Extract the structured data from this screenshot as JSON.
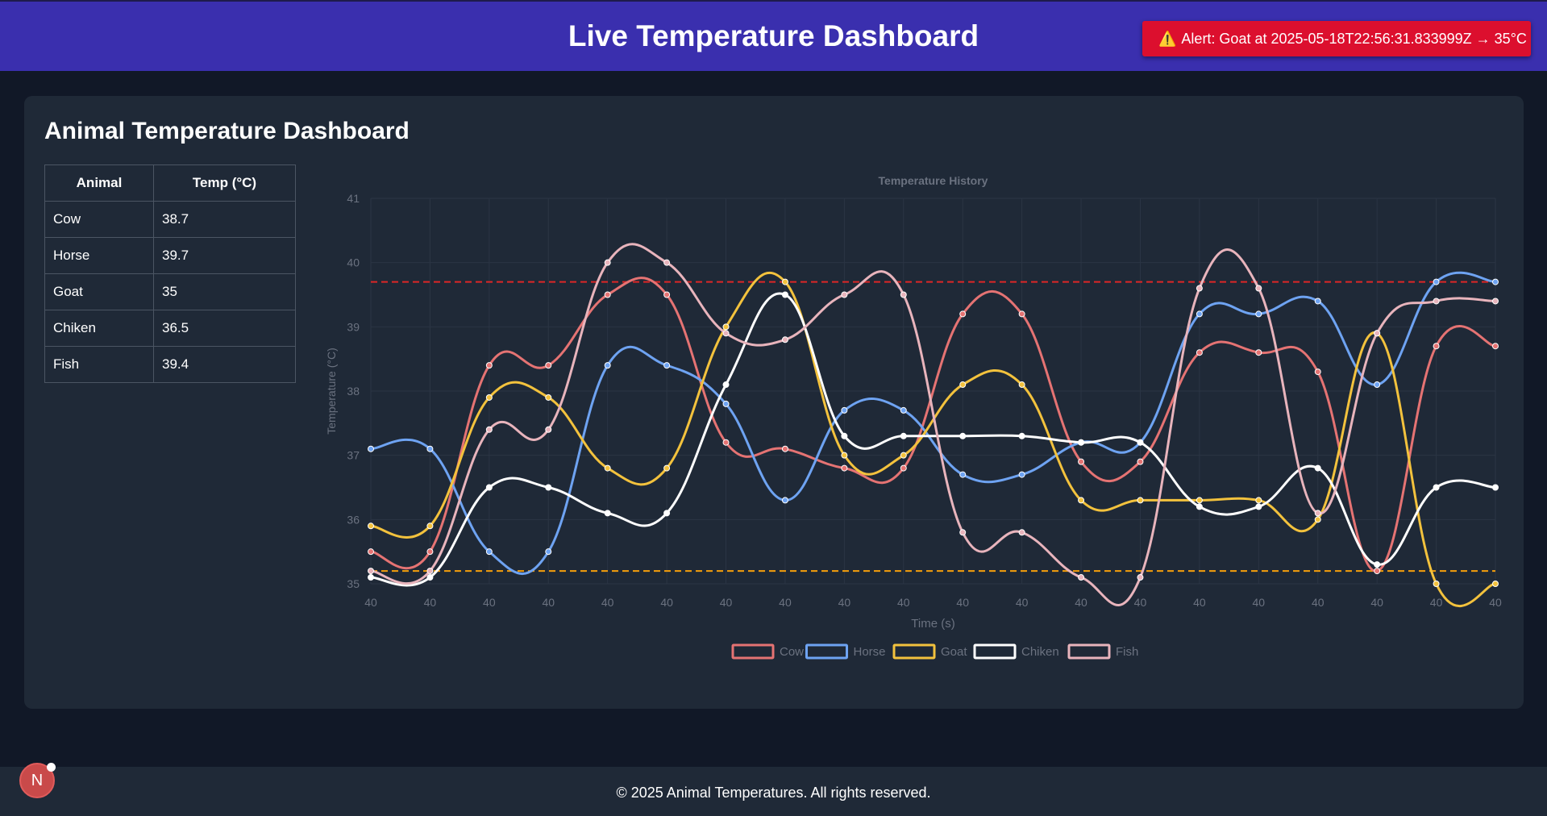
{
  "header": {
    "title": "Live Temperature Dashboard",
    "alert_icon": "⚠️",
    "alert_text": "Alert: Goat at 2025-05-18T22:56:31.833999Z → 35°C"
  },
  "main": {
    "title": "Animal Temperature Dashboard",
    "table": {
      "headers": [
        "Animal",
        "Temp (°C)"
      ],
      "rows": [
        [
          "Cow",
          "38.7"
        ],
        [
          "Horse",
          "39.7"
        ],
        [
          "Goat",
          "35"
        ],
        [
          "Chiken",
          "36.5"
        ],
        [
          "Fish",
          "39.4"
        ]
      ]
    }
  },
  "chart_data": {
    "type": "line",
    "title": "Temperature History",
    "xlabel": "Time (s)",
    "ylabel": "Temperature (°C)",
    "ylim": [
      35,
      41
    ],
    "yticks": [
      "35",
      "36",
      "37",
      "38",
      "39",
      "40",
      "41"
    ],
    "categories": [
      "40",
      "40",
      "40",
      "40",
      "40",
      "40",
      "40",
      "40",
      "40",
      "40",
      "40",
      "40",
      "40",
      "40",
      "40",
      "40",
      "40",
      "40",
      "40",
      "40"
    ],
    "grid": true,
    "legend_position": "bottom",
    "thresholds": [
      {
        "value": 39.7,
        "color": "#dc2626"
      },
      {
        "value": 35.2,
        "color": "#f59e0b"
      }
    ],
    "series": [
      {
        "name": "Cow",
        "color": "#e57373",
        "values": [
          35.5,
          35.5,
          38.4,
          38.4,
          39.5,
          39.5,
          37.2,
          37.1,
          36.8,
          36.8,
          39.2,
          39.2,
          36.9,
          36.9,
          38.6,
          38.6,
          38.3,
          35.2,
          38.7,
          38.7
        ]
      },
      {
        "name": "Horse",
        "color": "#6ea3f2",
        "values": [
          37.1,
          37.1,
          35.5,
          35.5,
          38.4,
          38.4,
          37.8,
          36.3,
          37.7,
          37.7,
          36.7,
          36.7,
          37.2,
          37.2,
          39.2,
          39.2,
          39.4,
          38.1,
          39.7,
          39.7
        ]
      },
      {
        "name": "Goat",
        "color": "#f3c23d",
        "values": [
          35.9,
          35.9,
          37.9,
          37.9,
          36.8,
          36.8,
          39.0,
          39.7,
          37.0,
          37.0,
          38.1,
          38.1,
          36.3,
          36.3,
          36.3,
          36.3,
          36.0,
          38.9,
          35.0,
          35.0
        ]
      },
      {
        "name": "Chiken",
        "color": "#ffffff",
        "values": [
          35.1,
          35.1,
          36.5,
          36.5,
          36.1,
          36.1,
          38.1,
          39.5,
          37.3,
          37.3,
          37.3,
          37.3,
          37.2,
          37.2,
          36.2,
          36.2,
          36.8,
          35.3,
          36.5,
          36.5
        ]
      },
      {
        "name": "Fish",
        "color": "#e8b4bc",
        "values": [
          35.2,
          35.2,
          37.4,
          37.4,
          40.0,
          40.0,
          38.9,
          38.8,
          39.5,
          39.5,
          35.8,
          35.8,
          35.1,
          35.1,
          39.6,
          39.6,
          36.1,
          38.9,
          39.4,
          39.4
        ]
      }
    ]
  },
  "footer": {
    "text": "© 2025 Animal Temperatures. All rights reserved."
  },
  "avatar": {
    "letter": "N"
  }
}
